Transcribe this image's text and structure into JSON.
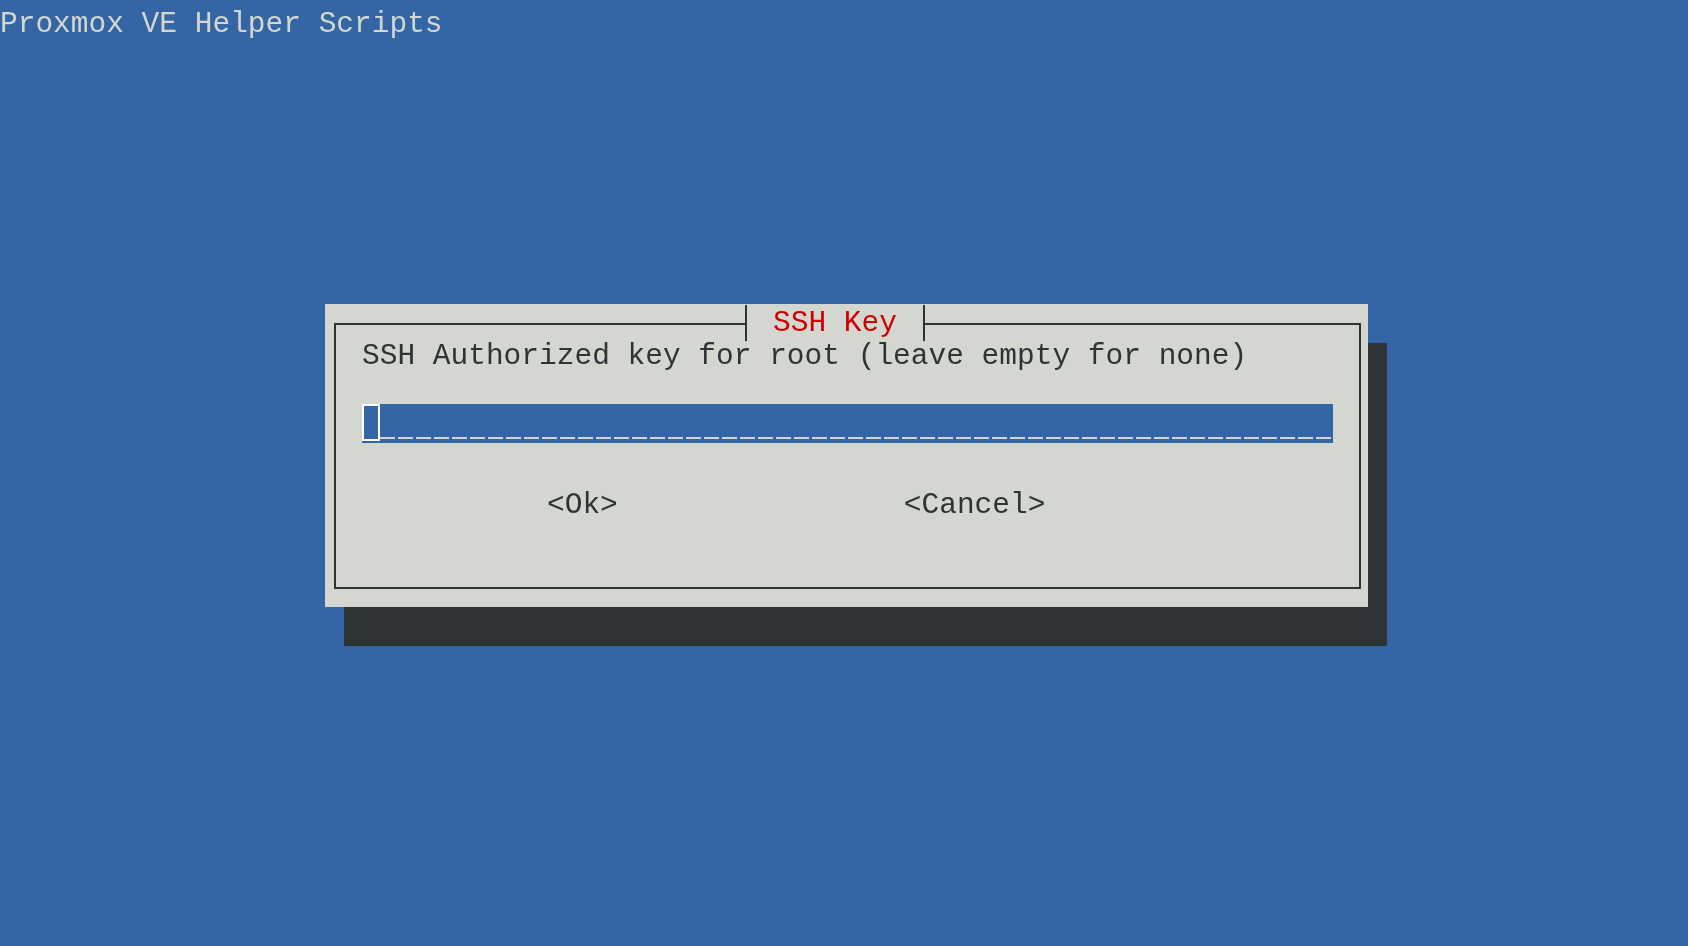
{
  "header": {
    "title": "Proxmox VE Helper Scripts"
  },
  "dialog": {
    "title": "SSH Key",
    "prompt": "SSH Authorized key for root (leave empty for none)",
    "input": {
      "focused": true
    },
    "buttons": [
      {
        "label": "<Ok>",
        "selected": false
      },
      {
        "label": "<Cancel>",
        "selected": false
      }
    ]
  }
}
